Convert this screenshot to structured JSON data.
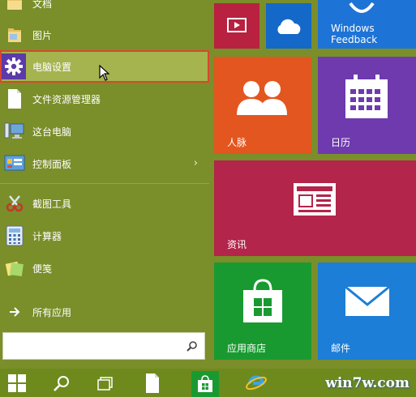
{
  "start_menu": {
    "items": [
      {
        "label": "文档",
        "icon": "documents-folder-icon"
      },
      {
        "label": "图片",
        "icon": "pictures-folder-icon"
      },
      {
        "label": "电脑设置",
        "icon": "gear-icon",
        "selected": true
      },
      {
        "label": "文件资源管理器",
        "icon": "file-explorer-icon"
      },
      {
        "label": "这台电脑",
        "icon": "this-pc-icon"
      },
      {
        "label": "控制面板",
        "icon": "control-panel-icon",
        "has_submenu": true
      },
      {
        "label": "截图工具",
        "icon": "snipping-tool-icon"
      },
      {
        "label": "计算器",
        "icon": "calculator-icon"
      },
      {
        "label": "便笺",
        "icon": "sticky-notes-icon"
      },
      {
        "label": "所有应用",
        "icon": "arrow-right-icon"
      }
    ],
    "search_placeholder": ""
  },
  "tiles": {
    "video": {
      "color": "#b8213f"
    },
    "onedrive": {
      "color": "#1468c8"
    },
    "feedback": {
      "label": "Windows Feedback",
      "color": "#1e73d6"
    },
    "people": {
      "label": "人脉",
      "color": "#e3561f"
    },
    "calendar": {
      "label": "日历",
      "color": "#6e3aad"
    },
    "news": {
      "label": "资讯",
      "color": "#b3254a"
    },
    "store": {
      "label": "应用商店",
      "color": "#199a31"
    },
    "mail": {
      "label": "邮件",
      "color": "#1c7ed6"
    }
  },
  "taskbar": {
    "watermark": "win7w.com",
    "buttons": [
      "start-button",
      "search-button",
      "task-view-button",
      "file-explorer-button",
      "store-button",
      "ie-button"
    ]
  }
}
